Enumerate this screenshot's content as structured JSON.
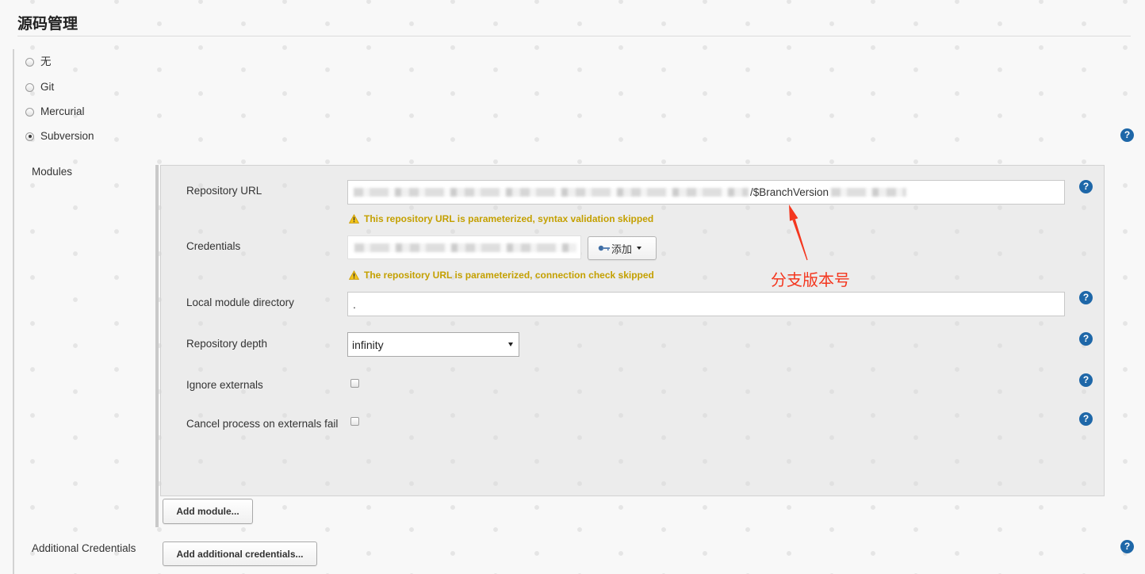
{
  "section": {
    "title": "源码管理"
  },
  "scm_options": [
    {
      "label": "无",
      "selected": false
    },
    {
      "label": "Git",
      "selected": false
    },
    {
      "label": "Mercurial",
      "selected": false
    },
    {
      "label": "Subversion",
      "selected": true
    }
  ],
  "modules": {
    "label": "Modules",
    "repository_url": {
      "label": "Repository URL",
      "visible_value": "/$BranchVersion",
      "warning": "This repository URL is parameterized, syntax validation skipped"
    },
    "credentials": {
      "label": "Credentials",
      "add_button_label": "添加",
      "warning": "The repository URL is parameterized, connection check skipped"
    },
    "local_module_directory": {
      "label": "Local module directory",
      "value": "."
    },
    "repository_depth": {
      "label": "Repository depth",
      "selected": "infinity"
    },
    "ignore_externals": {
      "label": "Ignore externals",
      "checked": false
    },
    "cancel_process_on_externals_fail": {
      "label": "Cancel process on externals fail",
      "checked": false
    },
    "add_module_button_label": "Add module..."
  },
  "additional_credentials": {
    "label": "Additional Credentials",
    "add_button_label": "Add additional credentials..."
  },
  "annotation": {
    "text": "分支版本号"
  },
  "icons": {
    "help": "help-icon",
    "warning": "warning-icon",
    "key": "key-icon",
    "dropdown": "caret-down-icon",
    "annotation_arrow": "red-arrow-icon"
  },
  "colors": {
    "warning_text": "#c4a000",
    "help_icon": "#1e67a8",
    "annotation": "#f4361e",
    "panel_background": "#ececec"
  }
}
